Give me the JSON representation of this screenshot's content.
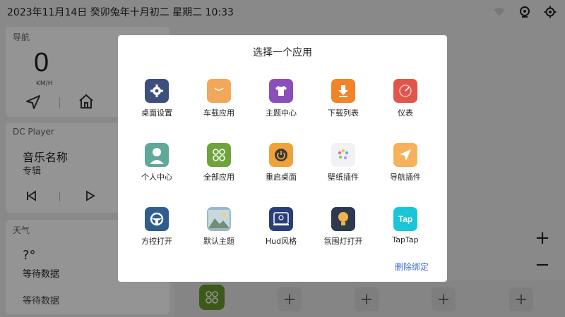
{
  "status_bar": {
    "datetime": "2023年11月14日  癸卯兔年十月初二  星期二  10:33",
    "icons": [
      "wifi-icon",
      "webcam-icon",
      "settings-gear-icon"
    ]
  },
  "nav_card": {
    "title": "导航",
    "speed": "0",
    "unit": "KM/H",
    "icons": [
      "navigate-arrow-icon",
      "home-icon"
    ]
  },
  "music_card": {
    "title": "DC Player",
    "song": "音乐名称",
    "album": "专辑",
    "icons": [
      "previous-track-icon",
      "play-icon"
    ]
  },
  "weather_card": {
    "title": "天气",
    "temperature": "?°",
    "status": "等待数据",
    "status2": "等待数据"
  },
  "dock": {
    "plus_label": "+"
  },
  "zoom": {
    "in": "+",
    "out": "−"
  },
  "dialog": {
    "title": "选择一个应用",
    "unbind_label": "删除绑定",
    "apps": [
      {
        "label": "桌面设置",
        "icon": "gear-icon",
        "color": "#3d4f7c"
      },
      {
        "label": "车载应用",
        "icon": "shopping-bag-icon",
        "color": "#f2a85a"
      },
      {
        "label": "主题中心",
        "icon": "tshirt-icon",
        "color": "#8a4fb8"
      },
      {
        "label": "下载列表",
        "icon": "download-icon",
        "color": "#f0842a"
      },
      {
        "label": "仪表",
        "icon": "gauge-icon",
        "color": "#e2554a"
      },
      {
        "label": "个人中心",
        "icon": "person-icon",
        "color": "#5fa89a"
      },
      {
        "label": "全部应用",
        "icon": "app-grid-icon",
        "color": "#6fa43a"
      },
      {
        "label": "重启桌面",
        "icon": "power-icon",
        "color": "#f0a23a"
      },
      {
        "label": "壁纸插件",
        "icon": "palette-icon",
        "color": "#f2f2f6"
      },
      {
        "label": "导航插件",
        "icon": "navigation-arrow-icon",
        "color": "#f5b25a"
      },
      {
        "label": "方控打开",
        "icon": "steering-wheel-icon",
        "color": "#2f5e8e"
      },
      {
        "label": "默认主题",
        "icon": "landscape-icon",
        "color": "#9bb8c6"
      },
      {
        "label": "Hud风格",
        "icon": "hud-display-icon",
        "color": "#2a3f7a"
      },
      {
        "label": "氛围灯打开",
        "icon": "lightbulb-icon",
        "color": "#2c3a4e"
      },
      {
        "label": "TapTap",
        "icon": "taptap-logo-icon",
        "color": "#19c6d8",
        "logo_text": "Tap"
      }
    ]
  }
}
